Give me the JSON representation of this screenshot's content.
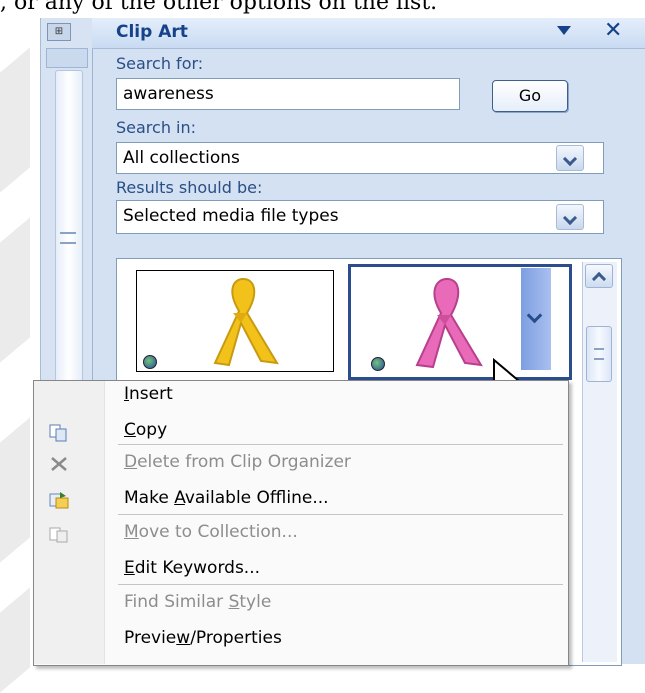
{
  "caption_text": ", or any of the other options on the list.",
  "pane": {
    "title": "Clip Art",
    "search_label": "Search for:",
    "search_value": "awareness",
    "go_label": "Go",
    "search_in_label": "Search in:",
    "search_in_value": "All collections",
    "results_label": "Results should be:",
    "results_value": "Selected media file types"
  },
  "results": [
    {
      "name": "yellow-ribbon",
      "color": "#f2c21a"
    },
    {
      "name": "pink-ribbon",
      "color": "#e86ab9"
    }
  ],
  "menu": {
    "items": [
      {
        "pre": "",
        "u": "I",
        "post": "nsert",
        "enabled": true,
        "icon": ""
      },
      {
        "pre": "",
        "u": "C",
        "post": "opy",
        "enabled": true,
        "icon": "copy-icon"
      },
      {
        "pre": "",
        "u": "D",
        "post": "elete from Clip Organizer",
        "enabled": false,
        "icon": "delete-icon"
      },
      {
        "pre": "Make ",
        "u": "A",
        "post": "vailable Offline...",
        "enabled": true,
        "icon": "offline-icon"
      },
      {
        "pre": "",
        "u": "M",
        "post": "ove to Collection...",
        "enabled": false,
        "icon": "move-icon"
      },
      {
        "pre": "",
        "u": "E",
        "post": "dit Keywords...",
        "enabled": true,
        "icon": ""
      },
      {
        "pre": "Find Similar ",
        "u": "S",
        "post": "tyle",
        "enabled": false,
        "icon": ""
      },
      {
        "pre": "Previe",
        "u": "w",
        "post": "/Properties",
        "enabled": true,
        "icon": ""
      }
    ]
  }
}
